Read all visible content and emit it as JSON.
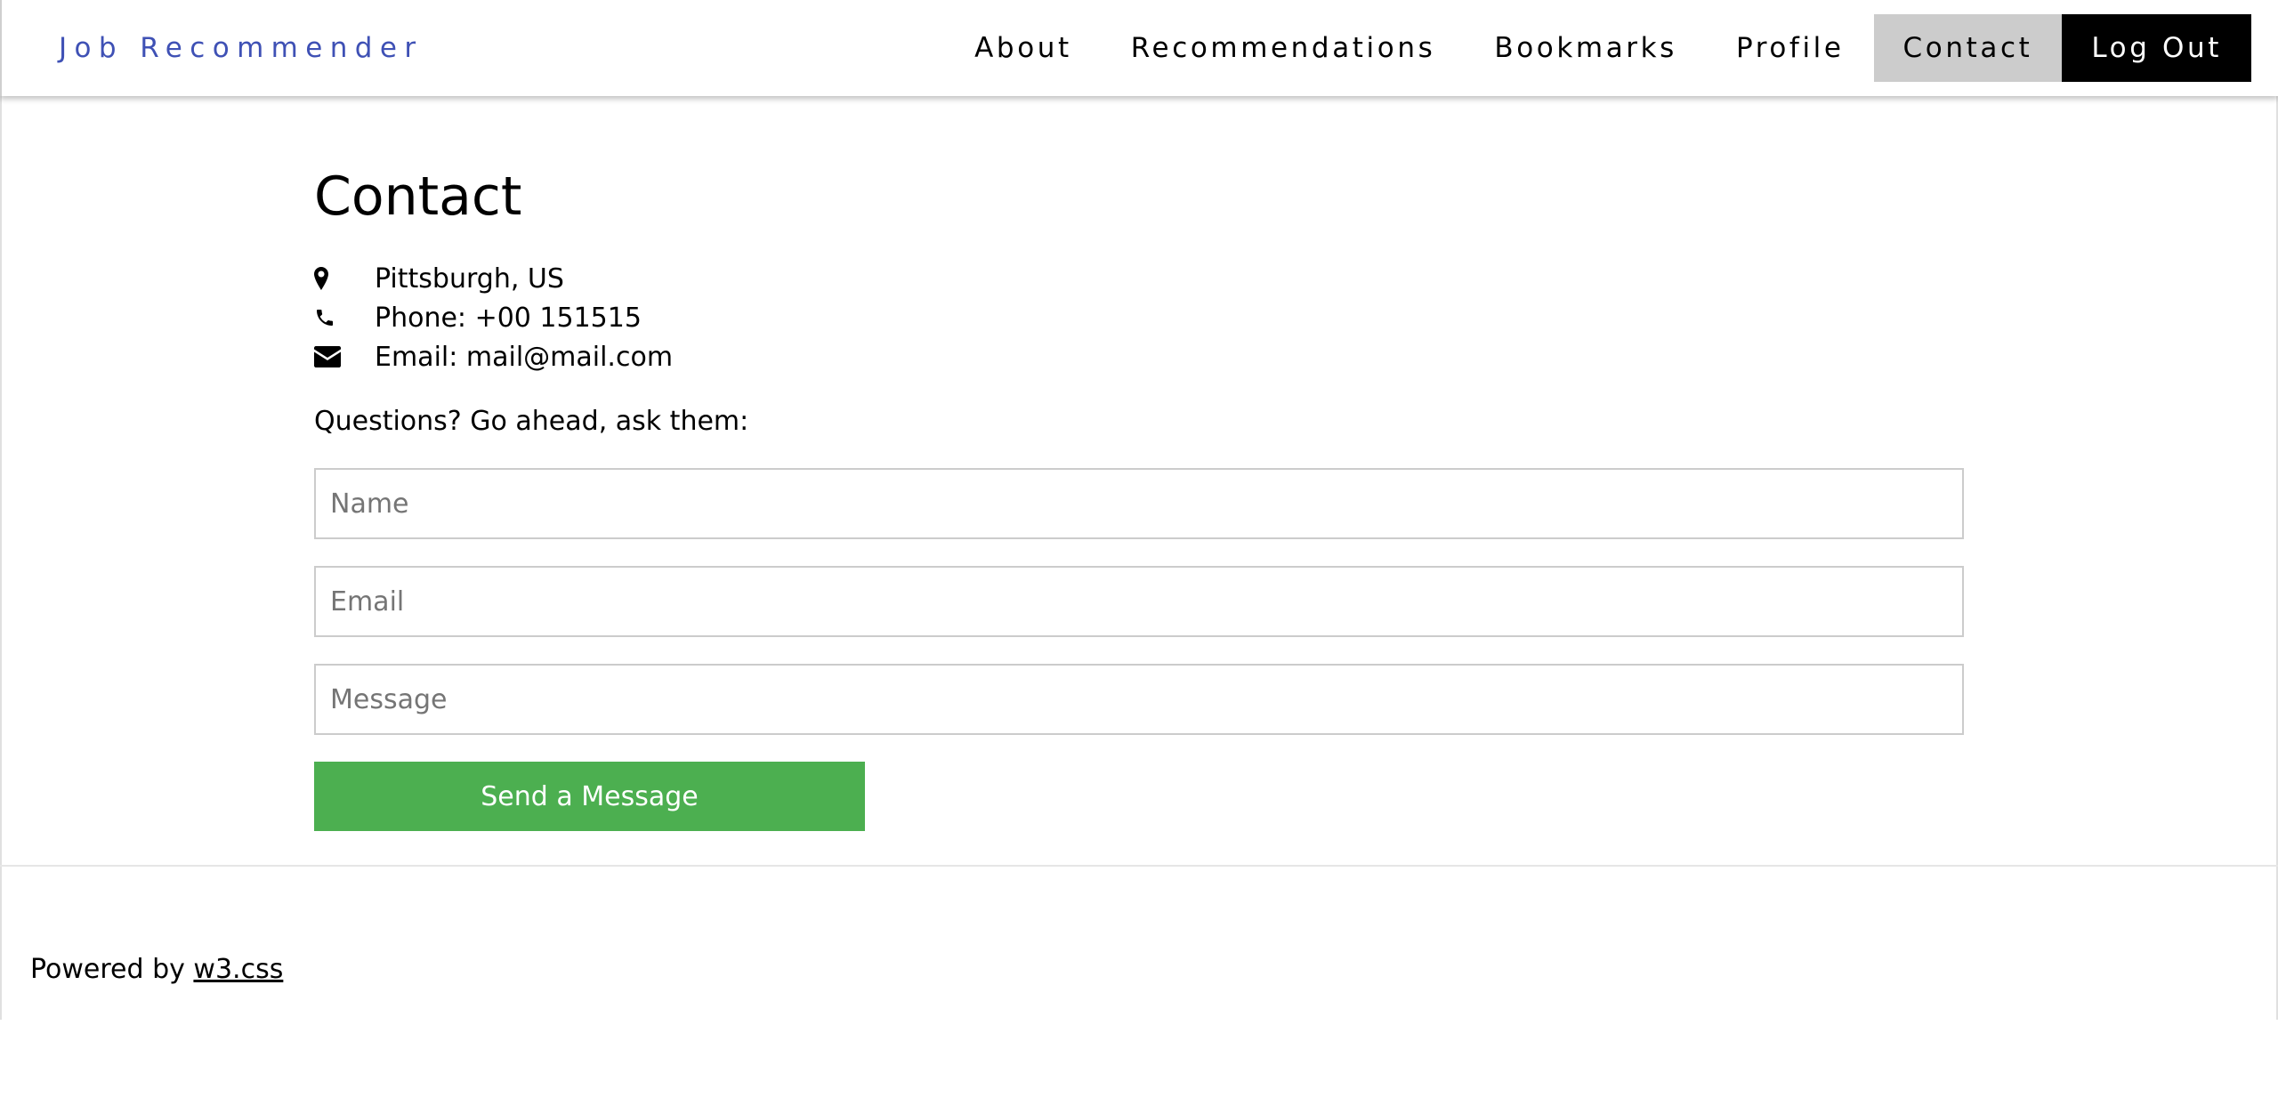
{
  "brand": {
    "name": "Job Recommender",
    "color": "#3f51b5"
  },
  "nav": {
    "items": [
      {
        "label": "About"
      },
      {
        "label": "Recommendations"
      },
      {
        "label": "Bookmarks"
      },
      {
        "label": "Profile"
      },
      {
        "label": "Contact",
        "active": true
      }
    ],
    "logout_label": "Log Out"
  },
  "contact": {
    "title": "Contact",
    "location": {
      "icon": "map-marker-icon",
      "text": "Pittsburgh, US"
    },
    "phone": {
      "icon": "phone-icon",
      "text": "Phone: +00 151515"
    },
    "email": {
      "icon": "envelope-icon",
      "text": "Email: mail@mail.com"
    },
    "question": "Questions? Go ahead, ask them:"
  },
  "form": {
    "name_placeholder": "Name",
    "email_placeholder": "Email",
    "message_placeholder": "Message",
    "send_label": "Send a Message",
    "send_color": "#4caf50"
  },
  "footer": {
    "prefix": "Powered by ",
    "link_text": "w3.css"
  }
}
